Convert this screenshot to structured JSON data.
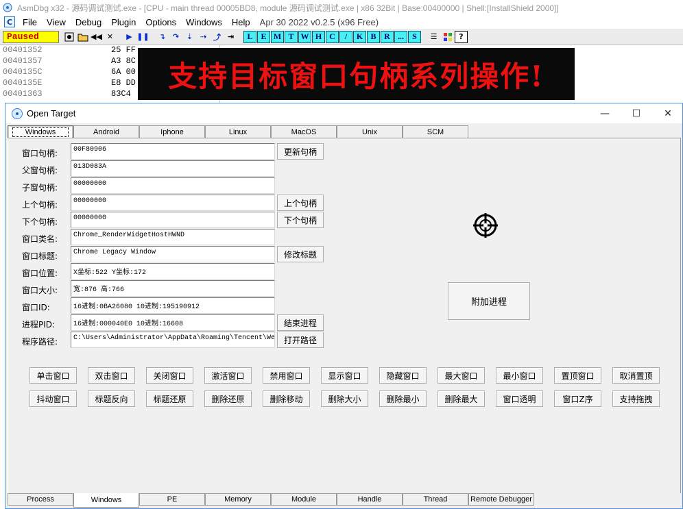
{
  "outer_window": {
    "title": "AsmDbg x32 - 源码调试测试.exe - [CPU - main thread 00005BD8, module 源码调试测试.exe | x86 32Bit | Base:00400000 | Shell:[InstallShield 2000]]",
    "menu": [
      "File",
      "View",
      "Debug",
      "Plugin",
      "Options",
      "Windows",
      "Help"
    ],
    "build_info": "Apr 30 2022  v0.2.5 (x96 Free)"
  },
  "toolbar": {
    "status": "Paused",
    "letter_buttons": [
      "L",
      "E",
      "M",
      "T",
      "W",
      "H",
      "C",
      "/",
      "K",
      "B",
      "R",
      "...",
      "S"
    ]
  },
  "disassembly": {
    "rows": [
      {
        "addr": "00401352",
        "bytes": "25 FF"
      },
      {
        "addr": "00401357",
        "bytes": "A3 8C"
      },
      {
        "addr": "0040135C",
        "bytes": "6A 00"
      },
      {
        "addr": "0040135E",
        "bytes": "E8 DD"
      },
      {
        "addr": "00401363",
        "bytes": "83C4"
      }
    ]
  },
  "banner": {
    "text": "支持目标窗口句柄系列操作!"
  },
  "dialog": {
    "title": "Open Target",
    "controls": {
      "minimize": "—",
      "maximize": "☐",
      "close": "✕"
    },
    "top_tabs": [
      "Windows",
      "Android",
      "Iphone",
      "Linux",
      "MacOS",
      "Unix",
      "SCM"
    ],
    "active_top_tab": "Windows",
    "fields": [
      {
        "label": "窗口句柄:",
        "value": "00F80906",
        "button": "更新句柄"
      },
      {
        "label": "父窗句柄:",
        "value": "013D083A",
        "button": ""
      },
      {
        "label": "子窗句柄:",
        "value": "00000000",
        "button": ""
      },
      {
        "label": "上个句柄:",
        "value": "00000000",
        "button": "上个句柄"
      },
      {
        "label": "下个句柄:",
        "value": "00000000",
        "button": "下个句柄"
      },
      {
        "label": "窗口类名:",
        "value": "Chrome_RenderWidgetHostHWND",
        "button": ""
      },
      {
        "label": "窗口标题:",
        "value": "Chrome Legacy Window",
        "button": "修改标题"
      },
      {
        "label": "窗口位置:",
        "value": "X坐标:522  Y坐标:172",
        "button": ""
      },
      {
        "label": "窗口大小:",
        "value": "宽:876  高:766",
        "button": ""
      },
      {
        "label": "窗口ID:",
        "value": "16进制:0BA26080 10进制:195190912",
        "button": ""
      },
      {
        "label": "进程PID:",
        "value": "16进制:000040E0 10进制:16608",
        "button": "结束进程"
      },
      {
        "label": "程序路径:",
        "value": "C:\\Users\\Administrator\\AppData\\Roaming\\Tencent\\We",
        "button": "打开路径"
      }
    ],
    "crosshair_icon": "target-finder-icon",
    "attach_button": "附加进程",
    "action_row_1": [
      "单击窗口",
      "双击窗口",
      "关闭窗口",
      "激活窗口",
      "禁用窗口",
      "显示窗口",
      "隐藏窗口",
      "最大窗口",
      "最小窗口",
      "置顶窗口",
      "取消置顶"
    ],
    "action_row_2": [
      "抖动窗口",
      "标题反向",
      "标题还原",
      "删除还原",
      "删除移动",
      "删除大小",
      "删除最小",
      "删除最大",
      "窗口透明",
      "窗口Z序",
      "支持拖拽"
    ],
    "bottom_tabs": [
      "Process",
      "Windows",
      "PE",
      "Memory",
      "Module",
      "Handle",
      "Thread",
      "Remote Debugger"
    ],
    "active_bottom_tab": "Windows"
  },
  "colors": {
    "paused_bg": "#ffff00",
    "paused_text": "#d00000",
    "banner_bg": "#0a0a0a",
    "banner_text": "#ee1111",
    "letter_button_bg": "#48f0f2",
    "dialog_border": "#4a90e2"
  }
}
